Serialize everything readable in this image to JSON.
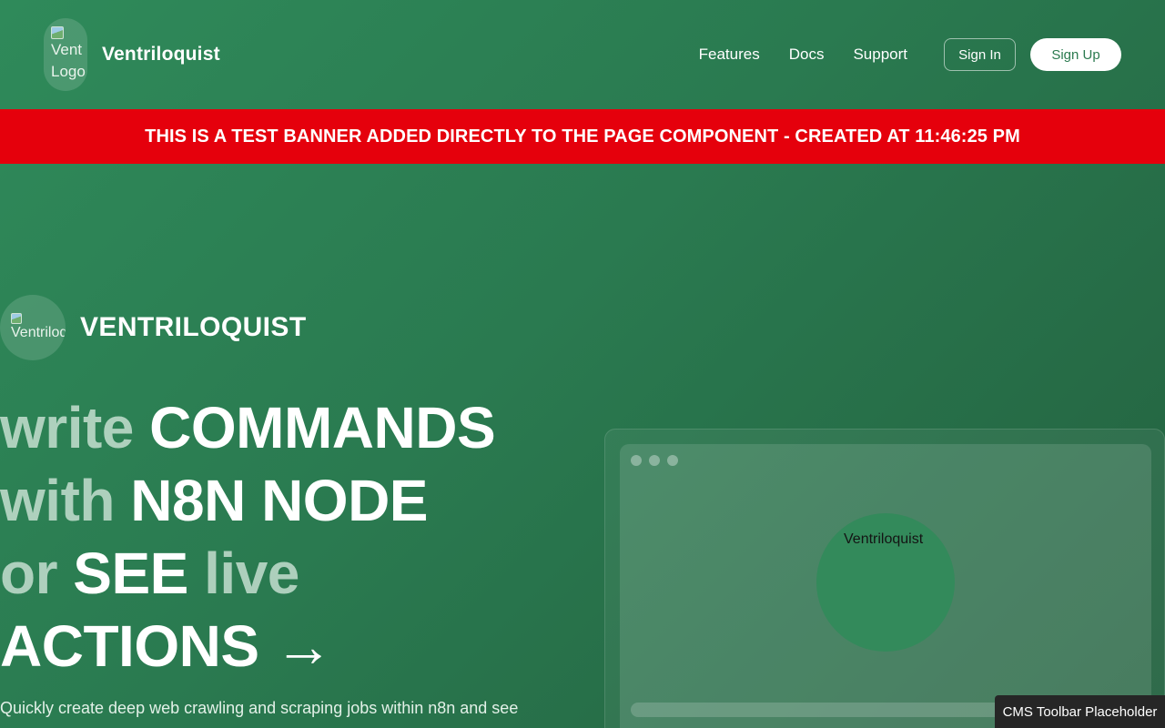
{
  "header": {
    "logo_alt": [
      "Vent",
      "Logo"
    ],
    "brand_name": "Ventriloquist",
    "nav": [
      "Features",
      "Docs",
      "Support"
    ],
    "sign_in": "Sign In",
    "sign_up": "Sign Up"
  },
  "banner": {
    "text": "THIS IS A TEST BANNER ADDED DIRECTLY TO THE PAGE COMPONENT - CREATED AT 11:46:25 PM",
    "color": "#e5000c"
  },
  "hero": {
    "logo_alt": "Ventriloquist",
    "brand_name": "VENTRILOQUIST",
    "headline": {
      "l1_muted": "write",
      "l1_strong": "COMMANDS",
      "l2_muted": "with",
      "l2_strong": "N8N NODE",
      "l3_muted_a": "or",
      "l3_strong": "SEE",
      "l3_muted_b": "live",
      "l4_strong": "ACTIONS",
      "arrow": "→"
    },
    "description": "Quickly create deep web crawling and scraping jobs within n8n and see"
  },
  "mockup": {
    "label": "Ventriloquist"
  },
  "cms_toolbar": "CMS Toolbar Placeholder",
  "colors": {
    "background": "#2a7a50",
    "accent_text": "#2b7a4f"
  }
}
